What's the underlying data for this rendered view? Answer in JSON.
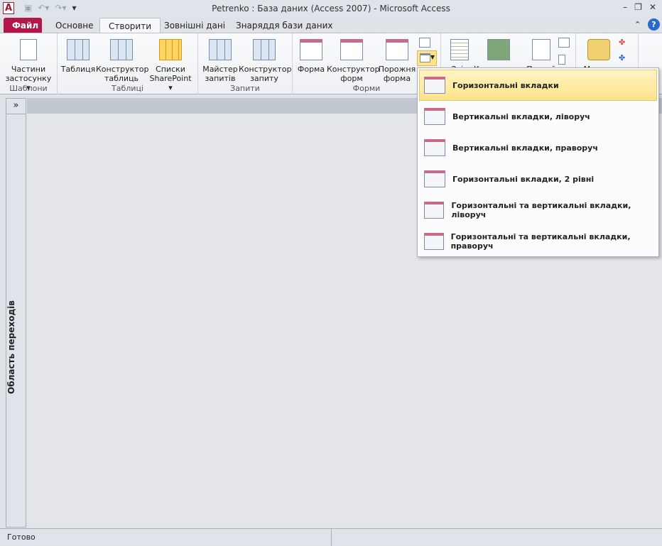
{
  "window": {
    "title": "Petrenko : База даних (Access 2007)  -  Microsoft Access",
    "app_icon": "A"
  },
  "tabs": [
    "Файл",
    "Основне",
    "Створити",
    "Зовнішні дані",
    "Знаряддя бази даних"
  ],
  "ribbon": {
    "groups": [
      {
        "label": "Шаблони",
        "buttons": [
          "Частини застосунку ▾"
        ]
      },
      {
        "label": "Таблиці",
        "buttons": [
          "Таблиця",
          "Конструктор таблиць",
          "Списки SharePoint ▾"
        ]
      },
      {
        "label": "Запити",
        "buttons": [
          "Майстер запитів",
          "Конструктор запиту"
        ]
      },
      {
        "label": "Форми",
        "buttons": [
          "Форма",
          "Конструктор форм",
          "Порожня форма"
        ]
      },
      {
        "label": "",
        "buttons": [
          "Звіт",
          "Конструктор",
          "Пустий",
          "Макрос"
        ]
      }
    ]
  },
  "nav": {
    "toggle": "»",
    "label": "Область переходів"
  },
  "menu": {
    "items": [
      "Горизонтальні вкладки",
      "Вертикальні вкладки, ліворуч",
      "Вертикальні вкладки, праворуч",
      "Горизонтальні вкладки, 2 рівні",
      "Горизонтальні та вертикальні вкладки, ліворуч",
      "Горизонтальні та вертикальні вкладки, праворуч"
    ]
  },
  "status": {
    "text": "Готово"
  }
}
